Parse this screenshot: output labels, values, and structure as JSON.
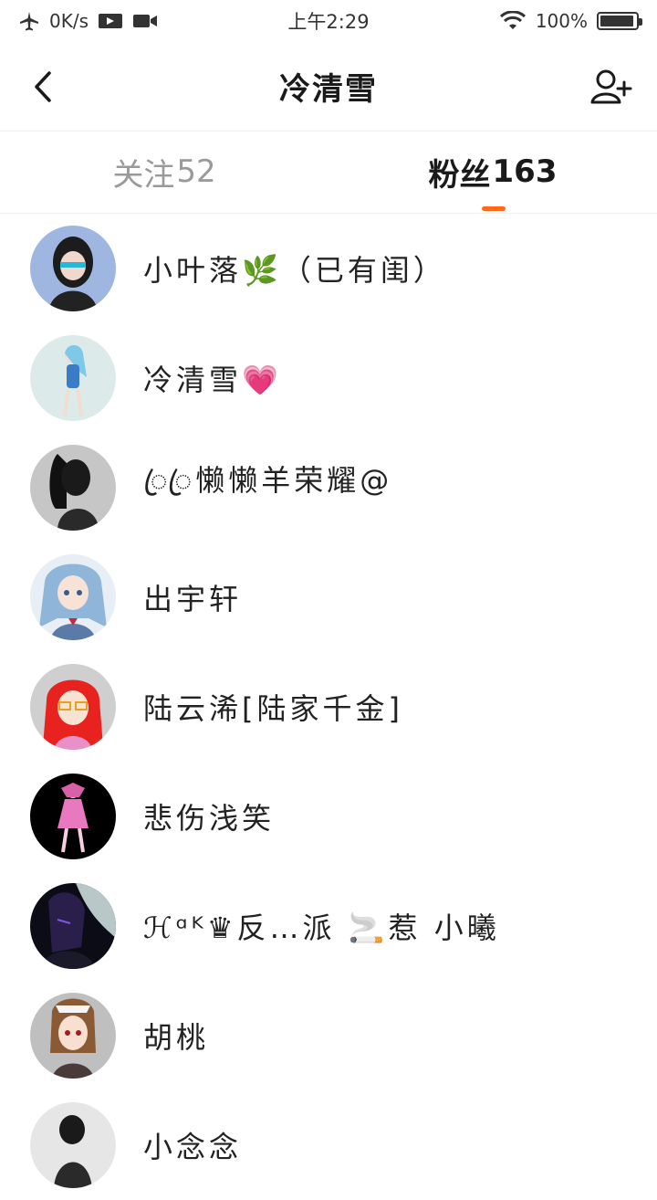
{
  "status_bar": {
    "speed": "0K/s",
    "time": "上午2:29",
    "battery": "100%",
    "icons": [
      "airplane-icon",
      "video-icon",
      "camera-icon",
      "wifi-icon",
      "battery-icon"
    ]
  },
  "header": {
    "title": "冷清雪",
    "back_icon": "chevron-left-icon",
    "add_icon": "add-user-icon"
  },
  "tabs": [
    {
      "label": "关注",
      "count": "52"
    },
    {
      "label": "粉丝",
      "count": "163",
      "active": true
    }
  ],
  "accent_color": "#ff6a1a",
  "followers": [
    {
      "name": "小叶落🌿（已有闺）"
    },
    {
      "name": "冷清雪💗"
    },
    {
      "name": "ꦿꦿ懒懒羊荣耀@"
    },
    {
      "name": "出宇轩"
    },
    {
      "name": "陆云浠[陆家千金]"
    },
    {
      "name": "悲伤浅笑"
    },
    {
      "name": "ℋᵅᴷ♛反…派 🚬惹 小曦"
    },
    {
      "name": "胡桃"
    },
    {
      "name": "小念念"
    }
  ]
}
